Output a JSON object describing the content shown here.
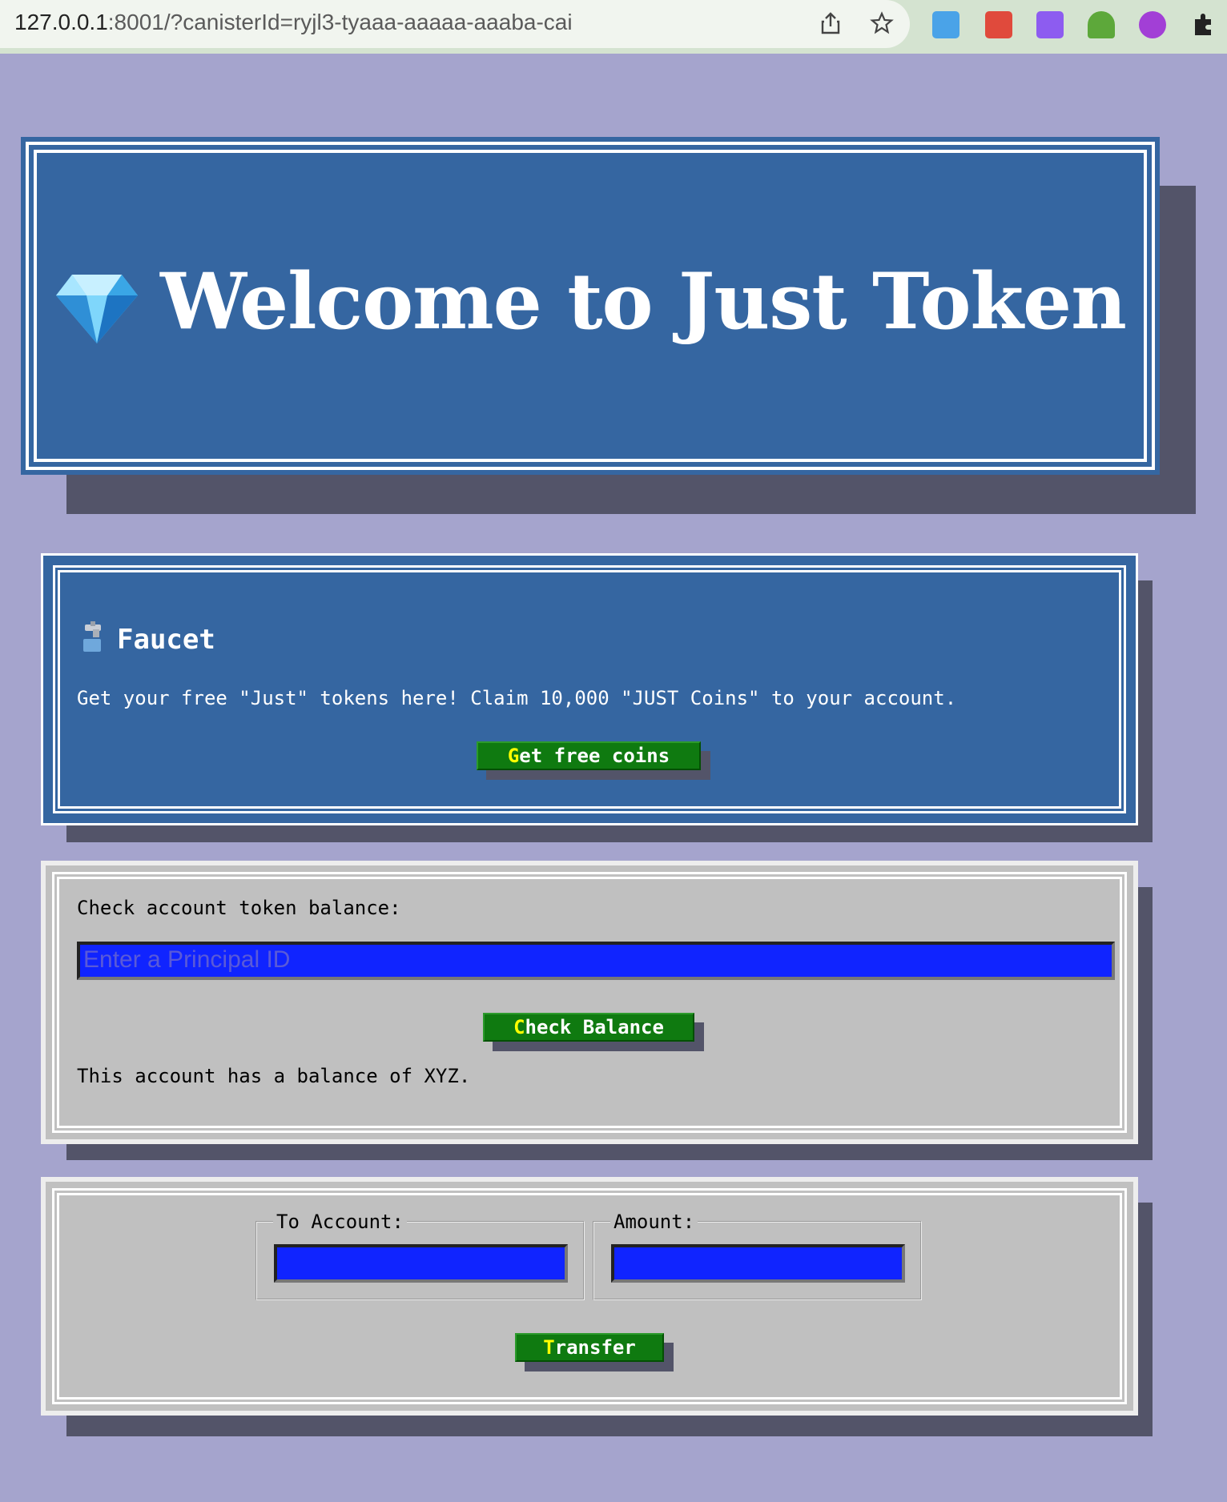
{
  "browser": {
    "url_host": "127.0.0.1",
    "url_rest": ":8001/?canisterId=ryjl3-tyaaa-aaaaa-aaaba-cai"
  },
  "hero": {
    "title": "Welcome to Just Token"
  },
  "faucet": {
    "heading": "Faucet",
    "description": "Get your free \"Just\" tokens here! Claim 10,000 \"JUST Coins\" to your account.",
    "button_first": "G",
    "button_rest": "et free coins"
  },
  "balance": {
    "label": "Check account token balance:",
    "placeholder": "Enter a Principal ID",
    "button_first": "C",
    "button_rest": "heck Balance",
    "result": "This account has a balance of XYZ."
  },
  "transfer": {
    "to_label": "To Account:",
    "amount_label": "Amount:",
    "button_first": "T",
    "button_rest": "ransfer"
  },
  "colors": {
    "page_bg": "#a5a4cd",
    "panel_blue": "#3566a1",
    "panel_grey": "#c0c0c0",
    "button_green": "#0f7a10",
    "input_blue": "#1024ff"
  }
}
